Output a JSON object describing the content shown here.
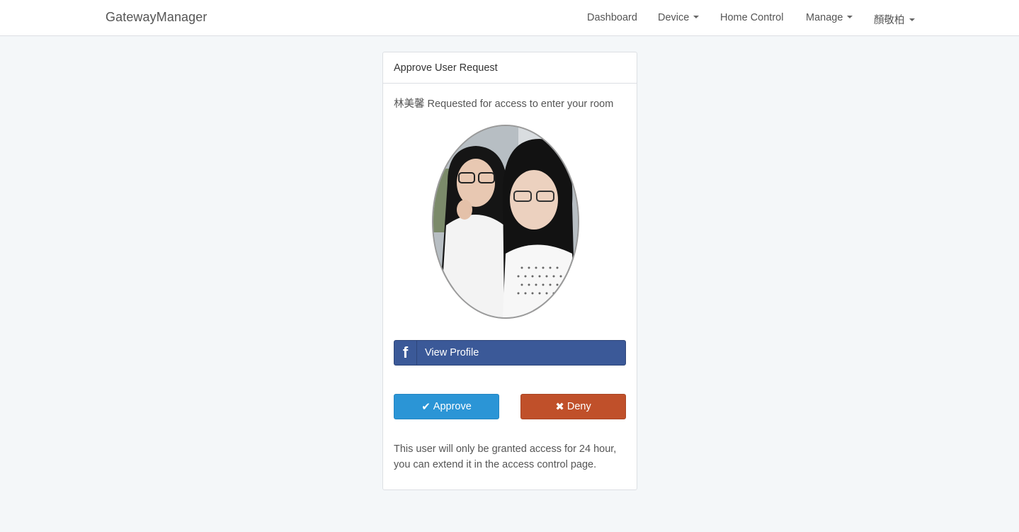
{
  "navbar": {
    "brand": "GatewayManager",
    "items": [
      {
        "label": "Dashboard",
        "dropdown": false
      },
      {
        "label": "Device",
        "dropdown": true
      },
      {
        "label": "Home Control",
        "dropdown": false
      },
      {
        "label": "Manage",
        "dropdown": true
      },
      {
        "label": "顏敬柏",
        "dropdown": true
      }
    ]
  },
  "panel": {
    "heading": "Approve User Request",
    "request_text": "林美馨 Requested for access to enter your room",
    "facebook": {
      "icon": "facebook-f-icon",
      "label": "View Profile"
    },
    "approve_label": "Approve",
    "deny_label": "Deny",
    "note_line1": "This user will only be granted access for 24 hour,",
    "note_line2": "you can extend it in the access control page."
  },
  "colors": {
    "background": "#f4f7f9",
    "facebook": "#3b5998",
    "approve": "#2b95d6",
    "deny": "#c0502a"
  }
}
